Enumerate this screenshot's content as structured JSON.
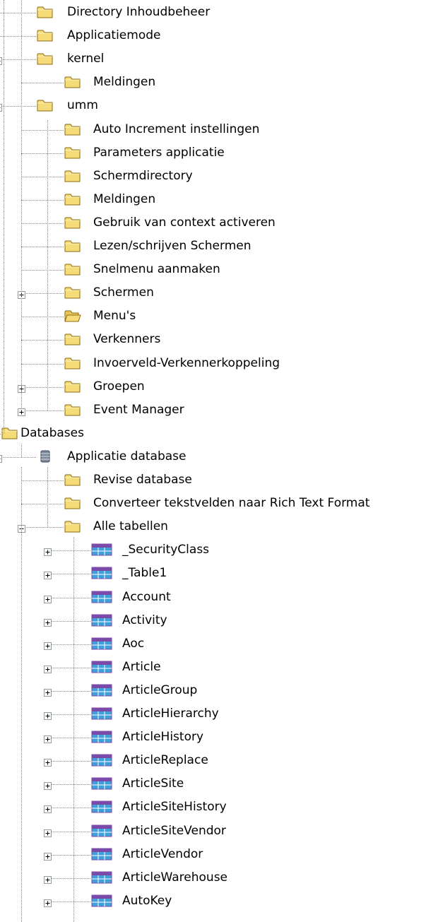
{
  "tree": {
    "items": [
      {
        "label": "Directory Inhoudbeheer",
        "icon": "folder-icon",
        "level": 1,
        "expander": "none"
      },
      {
        "label": "Applicatiemode",
        "icon": "folder-icon",
        "level": 1,
        "expander": "none"
      },
      {
        "label": "kernel",
        "icon": "folder-icon",
        "level": 1,
        "expander": "minus"
      },
      {
        "label": "Meldingen",
        "icon": "folder-icon",
        "level": 2,
        "expander": "none"
      },
      {
        "label": "umm",
        "icon": "folder-icon",
        "level": 1,
        "expander": "minus"
      },
      {
        "label": "Auto Increment instellingen",
        "icon": "folder-icon",
        "level": 2,
        "expander": "none"
      },
      {
        "label": "Parameters applicatie",
        "icon": "folder-icon",
        "level": 2,
        "expander": "none"
      },
      {
        "label": "Schermdirectory",
        "icon": "folder-icon",
        "level": 2,
        "expander": "none"
      },
      {
        "label": "Meldingen",
        "icon": "folder-icon",
        "level": 2,
        "expander": "none"
      },
      {
        "label": "Gebruik van context activeren",
        "icon": "folder-icon",
        "level": 2,
        "expander": "none"
      },
      {
        "label": "Lezen/schrijven Schermen",
        "icon": "folder-icon",
        "level": 2,
        "expander": "none"
      },
      {
        "label": "Snelmenu aanmaken",
        "icon": "folder-icon",
        "level": 2,
        "expander": "none"
      },
      {
        "label": "Schermen",
        "icon": "folder-icon",
        "level": 2,
        "expander": "plus"
      },
      {
        "label": "Menu's",
        "icon": "folder-open-icon",
        "level": 2,
        "expander": "none"
      },
      {
        "label": "Verkenners",
        "icon": "folder-icon",
        "level": 2,
        "expander": "none"
      },
      {
        "label": "Invoerveld-Verkennerkoppeling",
        "icon": "folder-icon",
        "level": 2,
        "expander": "none"
      },
      {
        "label": "Groepen",
        "icon": "folder-icon",
        "level": 2,
        "expander": "plus"
      },
      {
        "label": "Event Manager",
        "icon": "folder-icon",
        "level": 2,
        "expander": "plus"
      },
      {
        "label": "Databases",
        "icon": "folder-icon",
        "level": 0,
        "expander": "none"
      },
      {
        "label": "Applicatie database",
        "icon": "database-icon",
        "level": 1,
        "expander": "minus"
      },
      {
        "label": "Revise database",
        "icon": "folder-icon",
        "level": 2,
        "expander": "none"
      },
      {
        "label": "Converteer tekstvelden naar Rich Text Format",
        "icon": "folder-icon",
        "level": 2,
        "expander": "none"
      },
      {
        "label": "Alle tabellen",
        "icon": "folder-icon",
        "level": 2,
        "expander": "minus"
      },
      {
        "label": "_SecurityClass",
        "icon": "table-icon",
        "level": 3,
        "expander": "plus"
      },
      {
        "label": "_Table1",
        "icon": "table-icon",
        "level": 3,
        "expander": "plus"
      },
      {
        "label": "Account",
        "icon": "table-icon",
        "level": 3,
        "expander": "plus"
      },
      {
        "label": "Activity",
        "icon": "table-icon",
        "level": 3,
        "expander": "plus"
      },
      {
        "label": "Aoc",
        "icon": "table-icon",
        "level": 3,
        "expander": "plus"
      },
      {
        "label": "Article",
        "icon": "table-icon",
        "level": 3,
        "expander": "plus"
      },
      {
        "label": "ArticleGroup",
        "icon": "table-icon",
        "level": 3,
        "expander": "plus"
      },
      {
        "label": "ArticleHierarchy",
        "icon": "table-icon",
        "level": 3,
        "expander": "plus"
      },
      {
        "label": "ArticleHistory",
        "icon": "table-icon",
        "level": 3,
        "expander": "plus"
      },
      {
        "label": "ArticleReplace",
        "icon": "table-icon",
        "level": 3,
        "expander": "plus"
      },
      {
        "label": "ArticleSite",
        "icon": "table-icon",
        "level": 3,
        "expander": "plus"
      },
      {
        "label": "ArticleSiteHistory",
        "icon": "table-icon",
        "level": 3,
        "expander": "plus"
      },
      {
        "label": "ArticleSiteVendor",
        "icon": "table-icon",
        "level": 3,
        "expander": "plus"
      },
      {
        "label": "ArticleVendor",
        "icon": "table-icon",
        "level": 3,
        "expander": "plus"
      },
      {
        "label": "ArticleWarehouse",
        "icon": "table-icon",
        "level": 3,
        "expander": "plus"
      },
      {
        "label": "AutoKey",
        "icon": "table-icon",
        "level": 3,
        "expander": "plus"
      }
    ]
  },
  "colors": {
    "folder_fill": "#f5dc78",
    "folder_outline": "#8a6a10",
    "table_header": "#7b4aa8",
    "table_cell": "#3f9fd8",
    "database": "#7d8a99"
  }
}
